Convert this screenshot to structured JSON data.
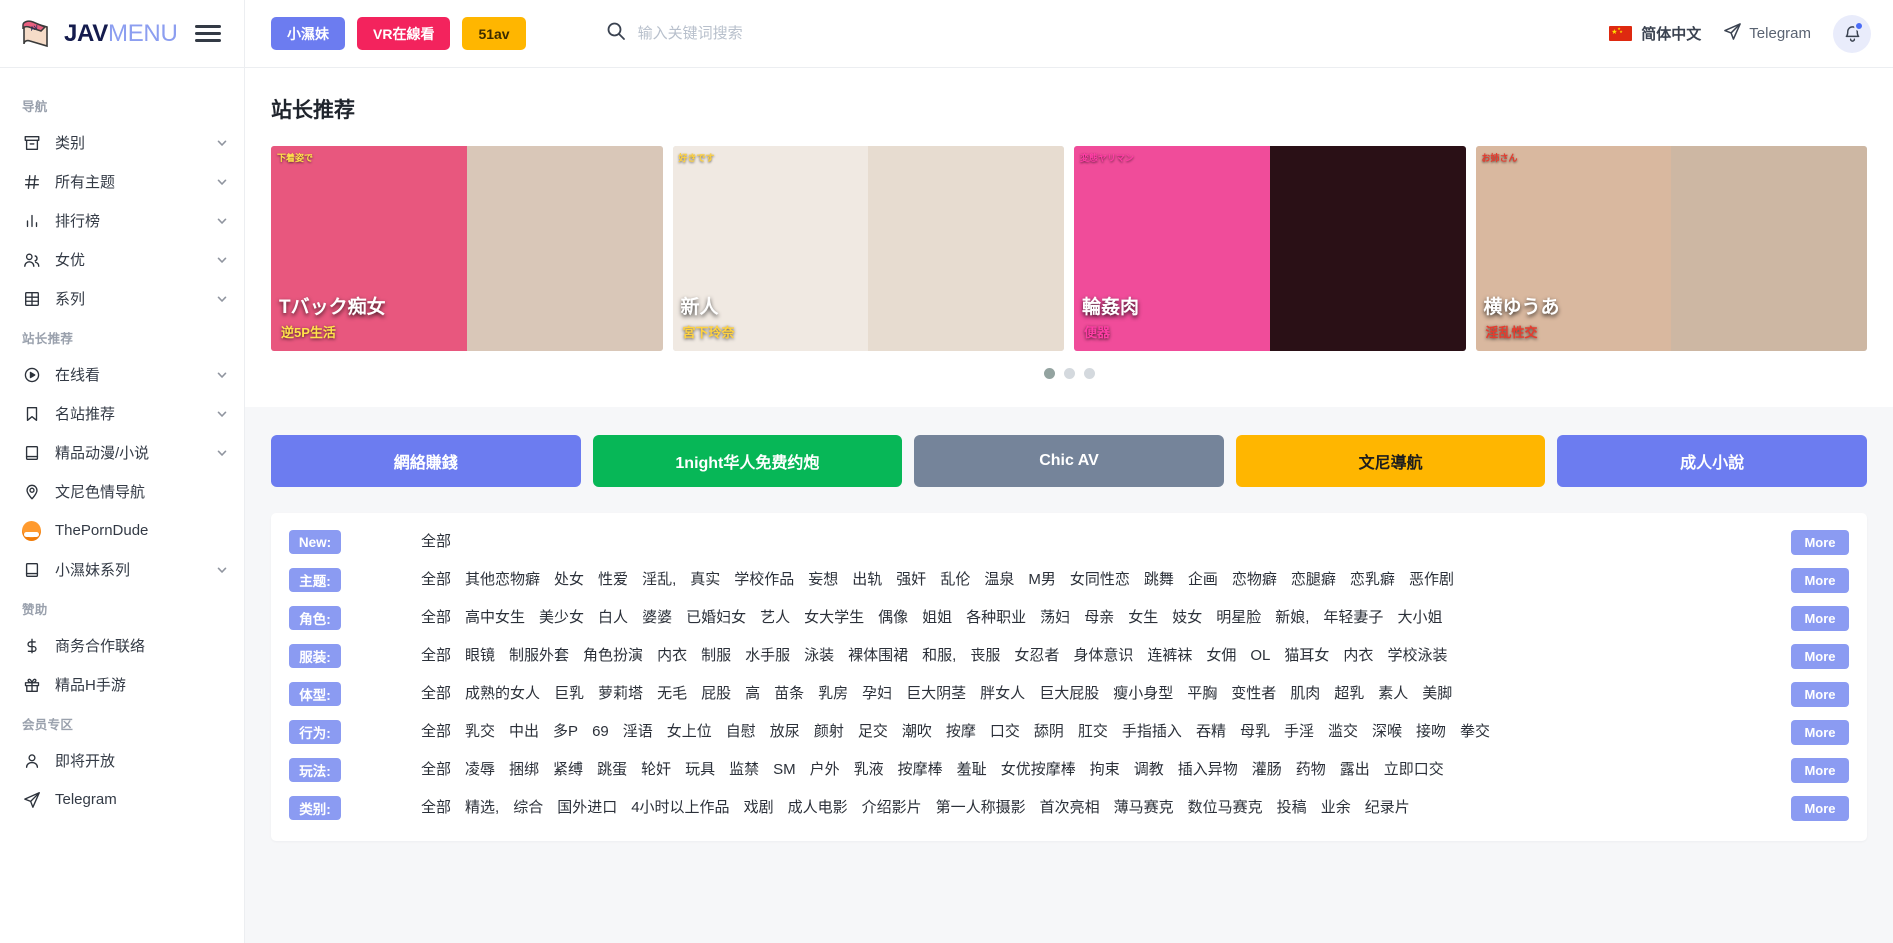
{
  "brand": {
    "name_part1": "JAV",
    "name_part2": "MENU",
    "logo_icon": "book-icon",
    "menu_icon": "hamburger-icon"
  },
  "header": {
    "promos": [
      {
        "label": "小濕妹",
        "color": "#6c7cf0"
      },
      {
        "label": "VR在線看",
        "color": "#f3235d"
      },
      {
        "label": "51av",
        "color": "#ffb600"
      }
    ],
    "search": {
      "placeholder": "输入关键词搜索",
      "value": "",
      "icon": "search-icon"
    },
    "language": {
      "label": "简体中文",
      "icon": "flag-china-icon"
    },
    "telegram": {
      "label": "Telegram",
      "icon": "telegram-send-icon"
    },
    "notifications": {
      "icon": "bell-icon",
      "has_unread": true
    }
  },
  "sidebar": {
    "groups": [
      {
        "title": "导航",
        "items": [
          {
            "label": "类别",
            "icon": "archive-icon",
            "chevron": true
          },
          {
            "label": "所有主题",
            "icon": "hash-icon",
            "chevron": true
          },
          {
            "label": "排行榜",
            "icon": "bar-chart-icon",
            "chevron": true
          },
          {
            "label": "女优",
            "icon": "users-icon",
            "chevron": true
          },
          {
            "label": "系列",
            "icon": "film-grid-icon",
            "chevron": true
          }
        ]
      },
      {
        "title": "站长推荐",
        "items": [
          {
            "label": "在线看",
            "icon": "play-circle-icon",
            "chevron": true
          },
          {
            "label": "名站推荐",
            "icon": "bookmark-icon",
            "chevron": true
          },
          {
            "label": "精品动漫/小说",
            "icon": "book-open-icon",
            "chevron": true
          },
          {
            "label": "文尼色情导航",
            "icon": "map-pin-icon",
            "chevron": false
          },
          {
            "label": "ThePornDude",
            "icon": "porndude-logo-icon",
            "chevron": false
          },
          {
            "label": "小濕妹系列",
            "icon": "book-open-icon",
            "chevron": true
          }
        ]
      },
      {
        "title": "赞助",
        "items": [
          {
            "label": "商务合作联络",
            "icon": "dollar-icon",
            "chevron": false
          },
          {
            "label": "精品H手游",
            "icon": "gift-icon",
            "chevron": false
          }
        ]
      },
      {
        "title": "会员专区",
        "items": [
          {
            "label": "即将开放",
            "icon": "user-icon",
            "chevron": false
          },
          {
            "label": "Telegram",
            "icon": "telegram-send-icon",
            "chevron": false
          }
        ]
      }
    ]
  },
  "recommend": {
    "title": "站长推荐",
    "covers": [
      {
        "alt": "cover-1",
        "left_bg": "#e8577e",
        "right_bg": "#d9c7b8",
        "badge": "下着姿で",
        "big_text": "Tバック痴女",
        "sub_text": "逆5P生活",
        "accent": "#ffe24a"
      },
      {
        "alt": "cover-2",
        "left_bg": "#f0e9e2",
        "right_bg": "#e7dcd0",
        "badge": "好きです",
        "big_text": "新人",
        "sub_text": "宮下玲奈",
        "accent": "#ffd23f"
      },
      {
        "alt": "cover-3",
        "left_bg": "#f04c9a",
        "right_bg": "#2a1016",
        "badge": "変態ヤリマン",
        "big_text": "輪姦肉",
        "sub_text": "便器",
        "accent": "#ff3ea5"
      },
      {
        "alt": "cover-4",
        "left_bg": "#d9b89f",
        "right_bg": "#cdb7a3",
        "badge": "お姉さん",
        "big_text": "横ゆうあ",
        "sub_text": "淫乱性交",
        "accent": "#e63b2e"
      }
    ],
    "dots": [
      true,
      false,
      false
    ]
  },
  "promo_buttons": [
    {
      "label": "網絡賺錢",
      "color": "#6c7cf0",
      "text_color": "#ffffff"
    },
    {
      "label": "1night华人免费约炮",
      "color": "#07b757",
      "text_color": "#ffffff"
    },
    {
      "label": "Chic AV",
      "color": "#75849a",
      "text_color": "#ffffff"
    },
    {
      "label": "文尼導航",
      "color": "#ffb600",
      "text_color": "#1d1d1d"
    },
    {
      "label": "成人小說",
      "color": "#6c7cf0",
      "text_color": "#ffffff"
    }
  ],
  "tag_table": {
    "more_label": "More",
    "rows": [
      {
        "key": "New:",
        "items": [
          "全部"
        ]
      },
      {
        "key": "主题:",
        "items": [
          "全部",
          "其他恋物癖",
          "处女",
          "性爱",
          "淫乱,",
          "真实",
          "学校作品",
          "妄想",
          "出轨",
          "强奸",
          "乱伦",
          "温泉",
          "M男",
          "女同性恋",
          "跳舞",
          "企画",
          "恋物癖",
          "恋腿癖",
          "恋乳癖",
          "恶作剧"
        ]
      },
      {
        "key": "角色:",
        "items": [
          "全部",
          "高中女生",
          "美少女",
          "白人",
          "婆婆",
          "已婚妇女",
          "艺人",
          "女大学生",
          "偶像",
          "姐姐",
          "各种职业",
          "荡妇",
          "母亲",
          "女生",
          "妓女",
          "明星脸",
          "新娘,",
          "年轻妻子",
          "大小姐"
        ]
      },
      {
        "key": "服装:",
        "items": [
          "全部",
          "眼镜",
          "制服外套",
          "角色扮演",
          "内衣",
          "制服",
          "水手服",
          "泳装",
          "裸体围裙",
          "和服,",
          "丧服",
          "女忍者",
          "身体意识",
          "连裤袜",
          "女佣",
          "OL",
          "猫耳女",
          "内衣",
          "学校泳装"
        ]
      },
      {
        "key": "体型:",
        "items": [
          "全部",
          "成熟的女人",
          "巨乳",
          "萝莉塔",
          "无毛",
          "屁股",
          "高",
          "苗条",
          "乳房",
          "孕妇",
          "巨大阴茎",
          "胖女人",
          "巨大屁股",
          "瘦小身型",
          "平胸",
          "变性者",
          "肌肉",
          "超乳",
          "素人",
          "美脚"
        ]
      },
      {
        "key": "行为:",
        "items": [
          "全部",
          "乳交",
          "中出",
          "多P",
          "69",
          "淫语",
          "女上位",
          "自慰",
          "放尿",
          "颜射",
          "足交",
          "潮吹",
          "按摩",
          "口交",
          "舔阴",
          "肛交",
          "手指插入",
          "吞精",
          "母乳",
          "手淫",
          "滥交",
          "深喉",
          "接吻",
          "拳交"
        ]
      },
      {
        "key": "玩法:",
        "items": [
          "全部",
          "凌辱",
          "捆绑",
          "紧缚",
          "跳蛋",
          "轮奸",
          "玩具",
          "监禁",
          "SM",
          "户外",
          "乳液",
          "按摩棒",
          "羞耻",
          "女优按摩棒",
          "拘束",
          "调教",
          "插入异物",
          "灌肠",
          "药物",
          "露出",
          "立即口交"
        ]
      },
      {
        "key": "类别:",
        "items": [
          "全部",
          "精选,",
          "综合",
          "国外进口",
          "4小时以上作品",
          "戏剧",
          "成人电影",
          "介绍影片",
          "第一人称摄影",
          "首次亮相",
          "薄马赛克",
          "数位马赛克",
          "投稿",
          "业余",
          "纪录片"
        ]
      }
    ]
  }
}
